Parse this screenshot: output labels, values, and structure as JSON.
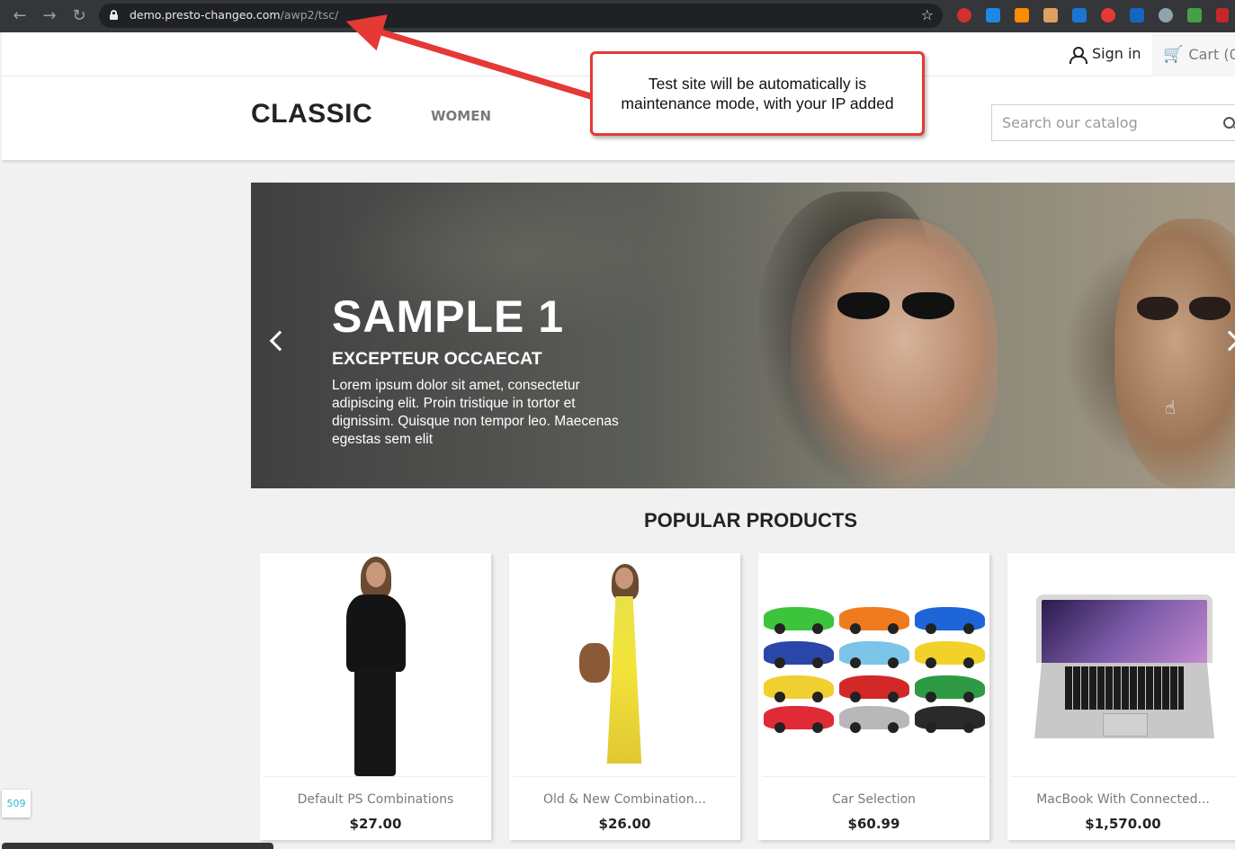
{
  "browser": {
    "url_host": "demo.presto-changeo.com",
    "url_path": "/awp2/tsc/"
  },
  "topbar": {
    "signin_label": "Sign in",
    "cart_label": "Cart (0"
  },
  "header": {
    "logo": "CLASSIC",
    "menu": [
      "WOMEN"
    ],
    "search_placeholder": "Search our catalog"
  },
  "slider": {
    "title": "SAMPLE 1",
    "subtitle": "EXCEPTEUR OCCAECAT",
    "text": "Lorem ipsum dolor sit amet, consectetur adipiscing elit. Proin tristique in tortor et dignissim. Quisque non tempor leo. Maecenas egestas sem elit"
  },
  "popular": {
    "title": "POPULAR PRODUCTS",
    "products": [
      {
        "name": "Default PS Combinations",
        "price": "$27.00"
      },
      {
        "name": "Old & New Combination...",
        "price": "$26.00"
      },
      {
        "name": "Car Selection",
        "price": "$60.99"
      },
      {
        "name": "MacBook With Connected...",
        "price": "$1,570.00"
      }
    ]
  },
  "badge": "509",
  "annotation": {
    "text": "Test site will be automatically is maintenance mode, with your IP added",
    "color": "#e53935"
  },
  "colors": {
    "accent": "#2fb5d2",
    "text_dark": "#232323",
    "text_muted": "#7a7a7a"
  }
}
